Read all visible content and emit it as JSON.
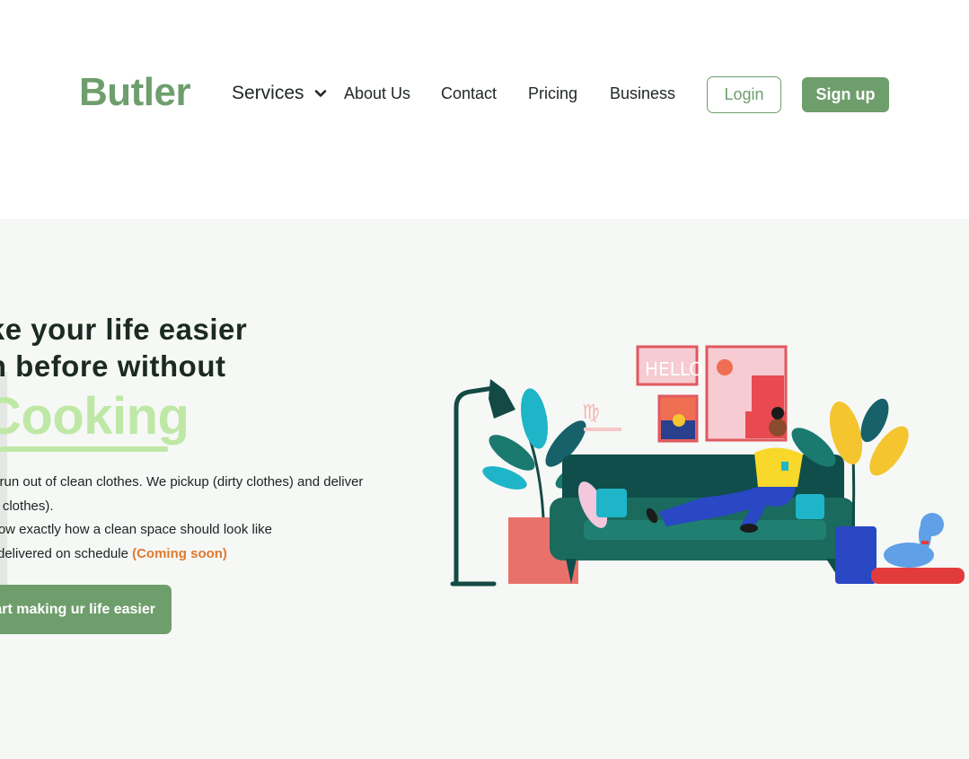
{
  "brand": {
    "logo": "Butler"
  },
  "nav": {
    "services": "Services",
    "about": "About Us",
    "contact": "Contact",
    "pricing": "Pricing",
    "business": "Business"
  },
  "auth": {
    "login": "Login",
    "signup": "Sign up"
  },
  "hero": {
    "headline_line1": "ake your life easier",
    "headline_line2": "an before without",
    "highlight": "Cooking",
    "body": {
      "line1": "er run out of clean clothes. We pickup (dirty clothes) and deliver",
      "line2": "an clothes).",
      "line3": "know exactly how a clean space should look like",
      "line4": "ls delivered on schedule",
      "line4_badge": "(Coming soon)"
    },
    "cta": "tart making ur life easier"
  },
  "illustration": {
    "poster_text": "HELLO",
    "icon": "couch-person-illustration"
  },
  "colors": {
    "brand_green": "#6f9e6d",
    "highlight_green": "#bfe8a6",
    "accent_orange": "#e07a2f",
    "hero_bg": "#f6f8f6"
  }
}
